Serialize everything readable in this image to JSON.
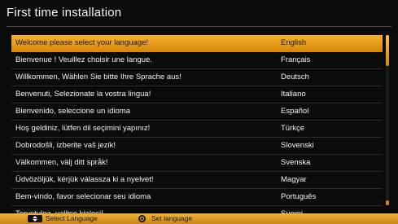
{
  "window": {
    "title": "First time installation"
  },
  "languages": [
    {
      "message": "Welcome please select your language!",
      "language": "English",
      "selected": true
    },
    {
      "message": "Bienvenue ! Veuillez choisir une langue.",
      "language": "Français"
    },
    {
      "message": "Willkommen, Wählen Sie bitte Ihre Sprache aus!",
      "language": "Deutsch"
    },
    {
      "message": "Benvenuti, Selezionate la vostra lingua!",
      "language": "Italiano"
    },
    {
      "message": "Bienvenido, seleccione un idioma",
      "language": "Español"
    },
    {
      "message": "Hoş geldiniz, lütfen dil seçimini yapınız!",
      "language": "Türkçe"
    },
    {
      "message": "Dobrodošli, izberite vaš jezik!",
      "language": "Slovenski"
    },
    {
      "message": "Välkommen, välj ditt språk!",
      "language": "Svenska"
    },
    {
      "message": "Üdvözöljük, kérjük válassza ki a nyelvet!",
      "language": "Magyar"
    },
    {
      "message": "Bem-vindo, favor selecionar seu idioma",
      "language": "Português"
    },
    {
      "message": "Tervetuloa, valitse kielesi!",
      "language": "Suomi"
    }
  ],
  "footer": {
    "select_label": "Select Language",
    "set_label": "Set language",
    "select_icon": "up-down-arrows-icon",
    "set_icon": "ok-button-icon"
  },
  "colors": {
    "highlight": "#f3b22b",
    "footer_bar": "#f0b53a",
    "background": "#0b0b0b"
  }
}
